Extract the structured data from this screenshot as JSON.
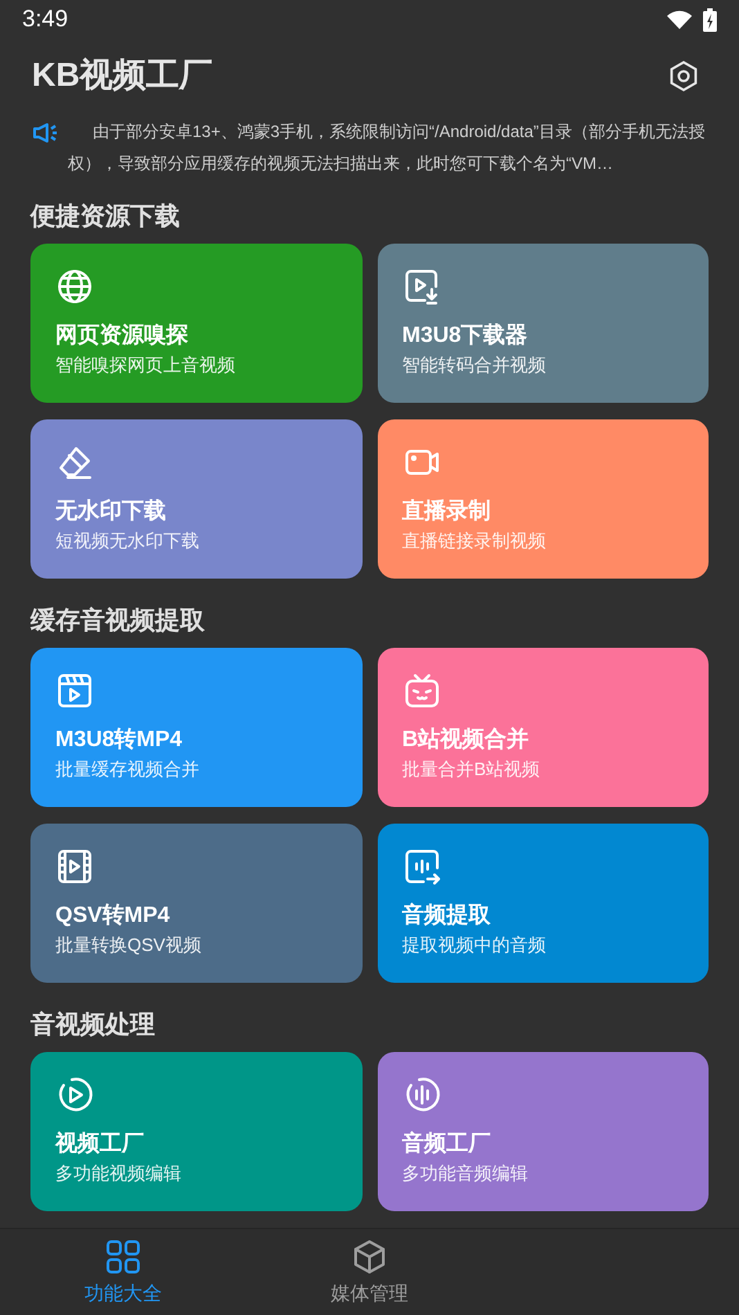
{
  "status_bar": {
    "time": "3:49"
  },
  "app_bar": {
    "title": "KB视频工厂"
  },
  "notice": {
    "text": "由于部分安卓13+、鸿蒙3手机，系统限制访问“/Android/data”目录（部分手机无法授权），导致部分应用缓存的视频无法扫描出来，此时您可下载个名为“VM…"
  },
  "sections": [
    {
      "title": "便捷资源下载",
      "cards": [
        {
          "kind": "globe",
          "title": "网页资源嗅探",
          "subtitle": "智能嗅探网页上音视频",
          "color": "#259b24"
        },
        {
          "kind": "video-download",
          "title": "M3U8下载器",
          "subtitle": "智能转码合并视频",
          "color": "#607d8b"
        },
        {
          "kind": "eraser",
          "title": "无水印下载",
          "subtitle": "短视频无水印下载",
          "color": "#7986cb"
        },
        {
          "kind": "camera",
          "title": "直播录制",
          "subtitle": "直播链接录制视频",
          "color": "#ff8a65"
        }
      ]
    },
    {
      "title": "缓存音视频提取",
      "cards": [
        {
          "kind": "clapper",
          "title": "M3U8转MP4",
          "subtitle": "批量缓存视频合并",
          "color": "#2196f3"
        },
        {
          "kind": "tv",
          "title": "B站视频合并",
          "subtitle": "批量合并B站视频",
          "color": "#fb7299"
        },
        {
          "kind": "film",
          "title": "QSV转MP4",
          "subtitle": "批量转换QSV视频",
          "color": "#4d6c89"
        },
        {
          "kind": "audio-export",
          "title": "音频提取",
          "subtitle": "提取视频中的音频",
          "color": "#0288d1"
        }
      ]
    },
    {
      "title": "音视频处理",
      "cards": [
        {
          "kind": "play-circle",
          "title": "视频工厂",
          "subtitle": "多功能视频编辑",
          "color": "#009688"
        },
        {
          "kind": "wave-circle",
          "title": "音频工厂",
          "subtitle": "多功能音频编辑",
          "color": "#9575cd"
        }
      ]
    }
  ],
  "bottom_nav": [
    {
      "kind": "grid",
      "label": "功能大全",
      "selected": true
    },
    {
      "kind": "cube",
      "label": "媒体管理",
      "selected": false
    }
  ]
}
